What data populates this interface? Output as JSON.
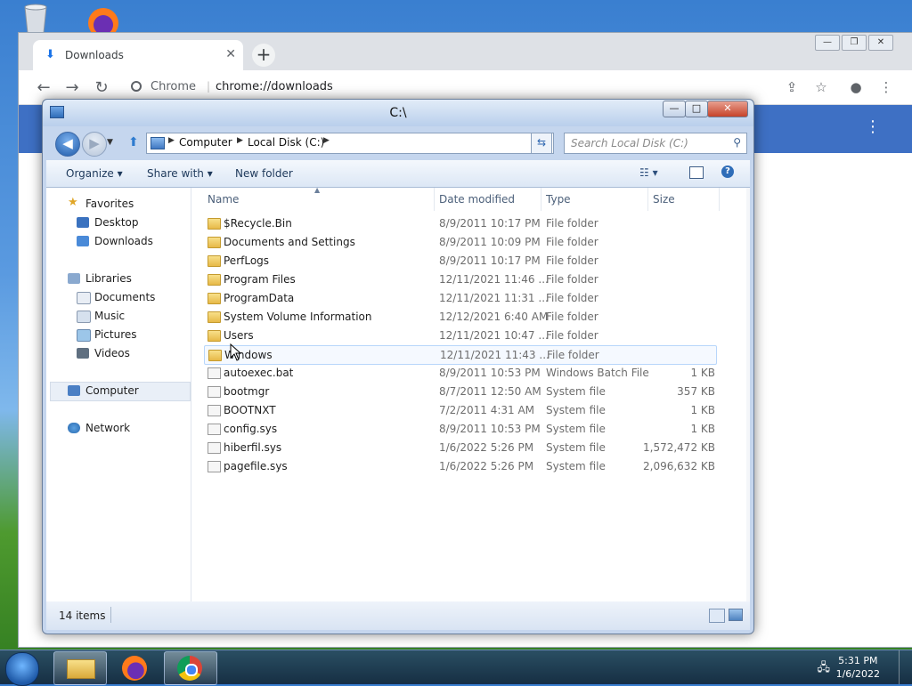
{
  "desktop": {
    "icons": [
      {
        "name": "recycle-bin-icon"
      },
      {
        "name": "firefox-icon"
      }
    ]
  },
  "chrome": {
    "tab_title": "Downloads",
    "tab_close": "✕",
    "new_tab": "+",
    "window_controls": {
      "minimize": "—",
      "maximize": "❐",
      "close": "✕"
    },
    "omnibox_site": "Chrome",
    "omnibox_sep": "|",
    "url": "chrome://downloads"
  },
  "explorer": {
    "title": "C:\\",
    "window_controls": {
      "minimize": "—",
      "maximize": "□",
      "close": "✕"
    },
    "breadcrumb": [
      "Computer",
      "Local Disk (C:)"
    ],
    "search_placeholder": "Search Local Disk (C:)",
    "commands": {
      "organize": "Organize ▾",
      "share": "Share with ▾",
      "new_folder": "New folder"
    },
    "nav": {
      "favorites": "Favorites",
      "favorites_items": [
        "Desktop",
        "Downloads"
      ],
      "libraries": "Libraries",
      "libraries_items": [
        "Documents",
        "Music",
        "Pictures",
        "Videos"
      ],
      "computer": "Computer",
      "network": "Network"
    },
    "columns": {
      "name": "Name",
      "date": "Date modified",
      "type": "Type",
      "size": "Size"
    },
    "files": [
      {
        "name": "$Recycle.Bin",
        "date": "8/9/2011 10:17 PM",
        "type": "File folder",
        "size": "",
        "kind": "folder"
      },
      {
        "name": "Documents and Settings",
        "date": "8/9/2011 10:09 PM",
        "type": "File folder",
        "size": "",
        "kind": "link"
      },
      {
        "name": "PerfLogs",
        "date": "8/9/2011 10:17 PM",
        "type": "File folder",
        "size": "",
        "kind": "folder"
      },
      {
        "name": "Program Files",
        "date": "12/11/2021 11:46 ...",
        "type": "File folder",
        "size": "",
        "kind": "folder"
      },
      {
        "name": "ProgramData",
        "date": "12/11/2021 11:31 ...",
        "type": "File folder",
        "size": "",
        "kind": "folder"
      },
      {
        "name": "System Volume Information",
        "date": "12/12/2021 6:40 AM",
        "type": "File folder",
        "size": "",
        "kind": "folder"
      },
      {
        "name": "Users",
        "date": "12/11/2021 10:47 ...",
        "type": "File folder",
        "size": "",
        "kind": "folder"
      },
      {
        "name": "Windows",
        "date": "12/11/2021 11:43 ...",
        "type": "File folder",
        "size": "",
        "kind": "folder"
      },
      {
        "name": "autoexec.bat",
        "date": "8/9/2011 10:53 PM",
        "type": "Windows Batch File",
        "size": "1 KB",
        "kind": "file"
      },
      {
        "name": "bootmgr",
        "date": "8/7/2011 12:50 AM",
        "type": "System file",
        "size": "357 KB",
        "kind": "file"
      },
      {
        "name": "BOOTNXT",
        "date": "7/2/2011 4:31 AM",
        "type": "System file",
        "size": "1 KB",
        "kind": "file"
      },
      {
        "name": "config.sys",
        "date": "8/9/2011 10:53 PM",
        "type": "System file",
        "size": "1 KB",
        "kind": "file"
      },
      {
        "name": "hiberfil.sys",
        "date": "1/6/2022 5:26 PM",
        "type": "System file",
        "size": "1,572,472 KB",
        "kind": "file"
      },
      {
        "name": "pagefile.sys",
        "date": "1/6/2022 5:26 PM",
        "type": "System file",
        "size": "2,096,632 KB",
        "kind": "file"
      }
    ],
    "status_count": "14 items"
  },
  "taskbar": {
    "time": "5:31 PM",
    "date": "1/6/2022"
  }
}
